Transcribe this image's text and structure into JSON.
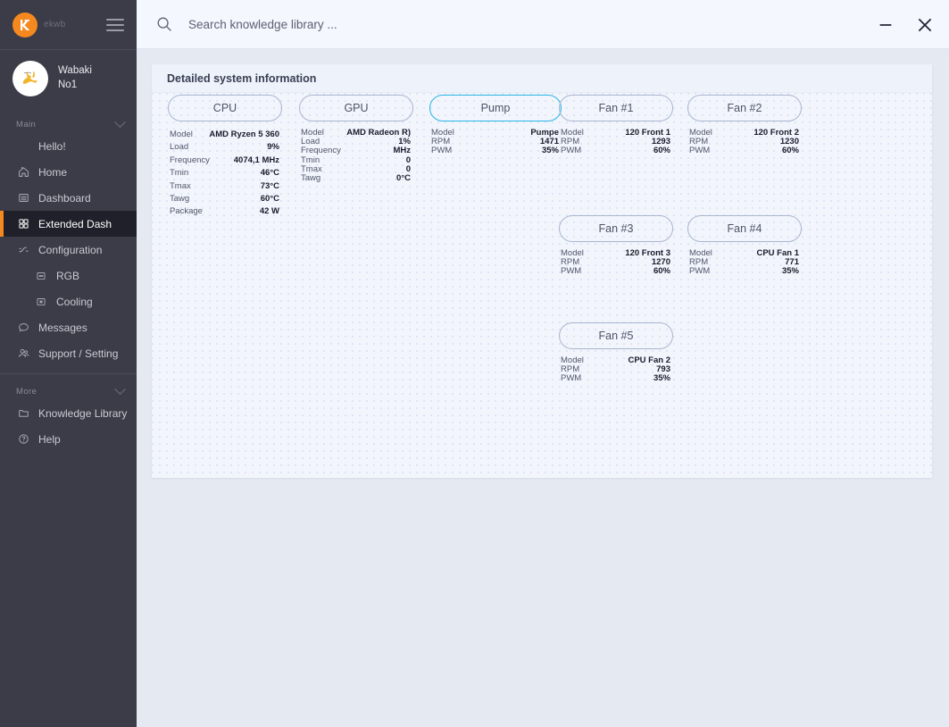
{
  "brand": {
    "name": "ekwb",
    "logo_icon": "ek-logo-icon",
    "menu_icon": "hamburger-icon"
  },
  "profile": {
    "avatar_icon": "user-avatar",
    "line1": "Wabaki",
    "line2": "No1"
  },
  "sidebar": {
    "sections": [
      {
        "label": "Main",
        "chevron_icon": "chevron-down-icon",
        "items": [
          {
            "label": "Hello!",
            "icon": "",
            "active": false,
            "sub": false
          },
          {
            "label": "Home",
            "icon": "home-icon",
            "active": false,
            "sub": false
          },
          {
            "label": "Dashboard",
            "icon": "dashboard-icon",
            "active": false,
            "sub": false
          },
          {
            "label": "Extended Dash",
            "icon": "grid-icon",
            "active": true,
            "sub": false
          },
          {
            "label": "Configuration",
            "icon": "sliders-icon",
            "active": false,
            "sub": false
          },
          {
            "label": "RGB",
            "icon": "rgb-icon",
            "active": false,
            "sub": true
          },
          {
            "label": "Cooling",
            "icon": "cooling-icon",
            "active": false,
            "sub": true
          },
          {
            "label": "Messages",
            "icon": "message-icon",
            "active": false,
            "sub": false
          },
          {
            "label": "Support / Setting",
            "icon": "support-icon",
            "active": false,
            "sub": false
          }
        ]
      },
      {
        "label": "More",
        "chevron_icon": "chevron-down-icon",
        "items": [
          {
            "label": "Knowledge Library",
            "icon": "folder-icon",
            "active": false,
            "sub": false
          },
          {
            "label": "Help",
            "icon": "help-icon",
            "active": false,
            "sub": false
          }
        ]
      }
    ]
  },
  "topbar": {
    "search_icon": "search-icon",
    "search_value": "",
    "search_placeholder": "Search knowledge library ...",
    "minimize_icon": "minimize-icon",
    "close_icon": "close-icon"
  },
  "panel": {
    "title": "Detailed system information"
  },
  "colors": {
    "sidebar_bg": "#3b3c47",
    "sidebar_active_bg": "#1f2029",
    "accent_orange": "#f5881f",
    "highlight_cyan": "#27b4e6",
    "panel_bg": "#f2f5fc",
    "app_bg": "#e4e9f2",
    "topbar_bg": "#f4f7fd"
  },
  "cards": [
    {
      "id": "cpu",
      "title": "CPU",
      "highlight": false,
      "pos": "pos-cpu",
      "width": "w-cpu",
      "spacing": "wide-rows",
      "rows": [
        {
          "key": "Model",
          "value": "AMD Ryzen 5 360"
        },
        {
          "key": "Load",
          "value": "9%"
        },
        {
          "key": "Frequency",
          "value": "4074,1 MHz"
        },
        {
          "key": "Tmin",
          "value": "46°C"
        },
        {
          "key": "Tmax",
          "value": "73°C"
        },
        {
          "key": "Tawg",
          "value": "60°C"
        },
        {
          "key": "Package",
          "value": "42 W"
        }
      ]
    },
    {
      "id": "gpu",
      "title": "GPU",
      "highlight": false,
      "pos": "pos-gpu",
      "width": "w-gpu",
      "spacing": "tight",
      "rows": [
        {
          "key": "Model",
          "value": "AMD Radeon R)"
        },
        {
          "key": "Load",
          "value": "1%"
        },
        {
          "key": "Frequency",
          "value": "MHz"
        },
        {
          "key": "Tmin",
          "value": "0"
        },
        {
          "key": "Tmax",
          "value": "0"
        },
        {
          "key": "Tawg",
          "value": "0°C"
        }
      ]
    },
    {
      "id": "pump",
      "title": "Pump",
      "highlight": true,
      "pos": "pos-pump",
      "width": "w-pump",
      "spacing": "tight",
      "rows": [
        {
          "key": "Model",
          "value": "Pumpe"
        },
        {
          "key": "RPM",
          "value": "1471"
        },
        {
          "key": "PWM",
          "value": "35%"
        }
      ]
    },
    {
      "id": "fan1",
      "title": "Fan #1",
      "highlight": false,
      "pos": "pos-fan1",
      "width": "w-fan",
      "spacing": "tight",
      "rows": [
        {
          "key": "Model",
          "value": "120 Front 1"
        },
        {
          "key": "RPM",
          "value": "1293"
        },
        {
          "key": "PWM",
          "value": "60%"
        }
      ]
    },
    {
      "id": "fan2",
      "title": "Fan #2",
      "highlight": false,
      "pos": "pos-fan2",
      "width": "w-fan",
      "spacing": "tight",
      "rows": [
        {
          "key": "Model",
          "value": "120 Front 2"
        },
        {
          "key": "RPM",
          "value": "1230"
        },
        {
          "key": "PWM",
          "value": "60%"
        }
      ]
    },
    {
      "id": "fan3",
      "title": "Fan #3",
      "highlight": false,
      "pos": "pos-fan3",
      "width": "w-fan",
      "spacing": "tight",
      "rows": [
        {
          "key": "Model",
          "value": "120 Front 3"
        },
        {
          "key": "RPM",
          "value": "1270"
        },
        {
          "key": "PWM",
          "value": "60%"
        }
      ]
    },
    {
      "id": "fan4",
      "title": "Fan #4",
      "highlight": false,
      "pos": "pos-fan4",
      "width": "w-fan",
      "spacing": "tight",
      "rows": [
        {
          "key": "Model",
          "value": "CPU Fan 1"
        },
        {
          "key": "RPM",
          "value": "771"
        },
        {
          "key": "PWM",
          "value": "35%"
        }
      ]
    },
    {
      "id": "fan5",
      "title": "Fan #5",
      "highlight": false,
      "pos": "pos-fan5",
      "width": "w-fan",
      "spacing": "tight",
      "rows": [
        {
          "key": "Model",
          "value": "CPU Fan 2"
        },
        {
          "key": "RPM",
          "value": "793"
        },
        {
          "key": "PWM",
          "value": "35%"
        }
      ]
    }
  ]
}
